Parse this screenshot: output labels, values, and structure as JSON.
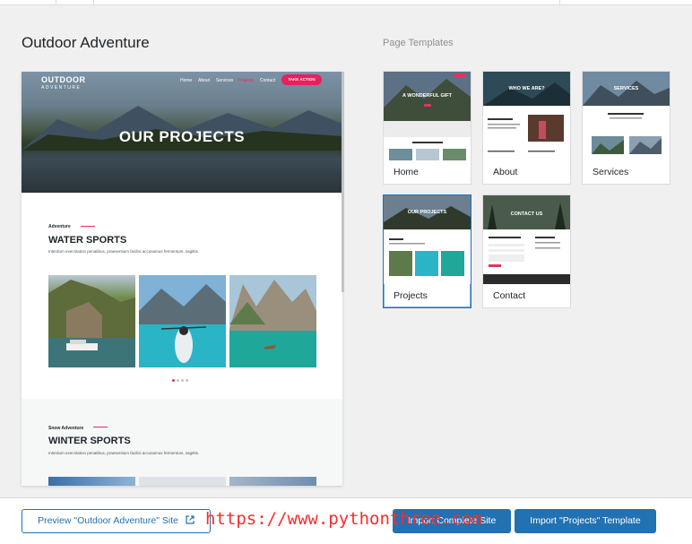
{
  "page": {
    "title": "Outdoor Adventure",
    "templates_label": "Page Templates"
  },
  "preview": {
    "logo_main": "OUTDOOR",
    "logo_sub": "ADVENTURE",
    "nav": [
      "Home",
      "About",
      "Services",
      "Projects",
      "Contact"
    ],
    "cta": "TAKE ACTION",
    "hero_heading": "OUR PROJECTS",
    "section1": {
      "label": "Adventure",
      "title": "WATER SPORTS",
      "text": "Interdum exercitation penatibus, praesentium facilisi accusamus fermentum, sagittis."
    },
    "section2": {
      "label": "Snow Adventure",
      "title": "WINTER SPORTS",
      "text": "Interdum exercitation penatibus, praesentium facilisi accusamus fermentum, sagittis."
    }
  },
  "templates": [
    {
      "name": "Home",
      "hero": "A WONDERFUL GIFT"
    },
    {
      "name": "About",
      "hero": "WHO WE ARE?"
    },
    {
      "name": "Services",
      "hero": "SERVICES"
    },
    {
      "name": "Projects",
      "hero": "OUR PROJECTS",
      "selected": true
    },
    {
      "name": "Contact",
      "hero": "CONTACT US"
    }
  ],
  "buttons": {
    "preview": "Preview \"Outdoor Adventure\" Site",
    "import_site": "Import Complete Site",
    "import_template": "Import \"Projects\" Template"
  },
  "watermark": "https://www.pythonthree.com",
  "colors": {
    "accent": "#2271b1",
    "brand_pink": "#e8305c"
  }
}
